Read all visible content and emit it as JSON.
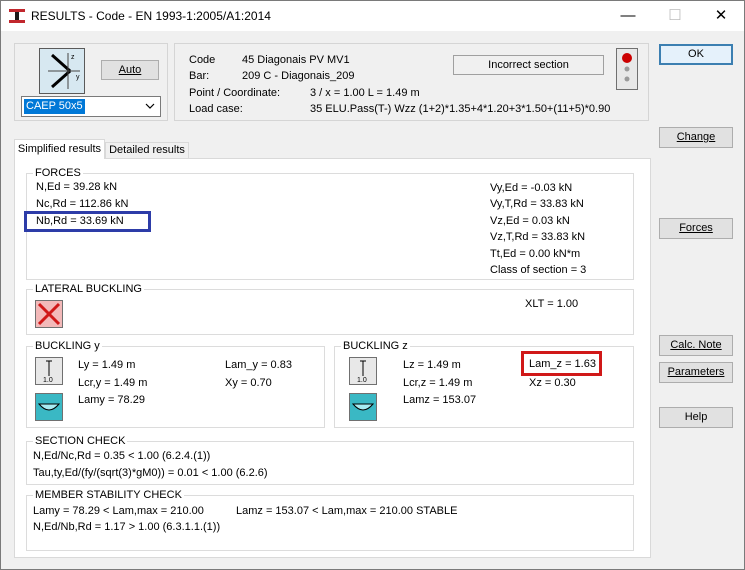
{
  "window": {
    "title": "RESULTS - Code - EN 1993-1:2005/A1:2014",
    "minimize": "—",
    "maximize": "☐",
    "close": "✕"
  },
  "header": {
    "auto_label": "Auto",
    "section_select": "CAEP 50x5",
    "code_label": "Code",
    "code_value": "45  Diagonais PV MV1",
    "bar_label": "Bar:",
    "bar_value": "209  C - Diagonais_209",
    "point_label": "Point / Coordinate:",
    "point_value": "3 / x = 1.00 L = 1.49 m",
    "load_label": "Load case:",
    "load_value": "35 ELU.Pass(T-) Wzz  (1+2)*1.35+4*1.20+3*1.50+(11+5)*0.90",
    "status": "Incorrect section"
  },
  "buttons": {
    "ok": "OK",
    "change": "Change",
    "forces": "Forces",
    "calc_note": "Calc. Note",
    "parameters": "Parameters",
    "help": "Help"
  },
  "tabs": {
    "simplified": "Simplified results",
    "detailed": "Detailed results"
  },
  "forces": {
    "title": "FORCES",
    "ned": "N,Ed = 39.28 kN",
    "ncrd": "Nc,Rd = 112.86 kN",
    "nbrd": "Nb,Rd = 33.69 kN",
    "vyed": "Vy,Ed = -0.03 kN",
    "vytrd": "Vy,T,Rd = 33.83 kN",
    "vzed": "Vz,Ed = 0.03 kN",
    "vztrd": "Vz,T,Rd = 33.83 kN",
    "tted": "Tt,Ed = 0.00 kN*m",
    "class": "Class of section = 3"
  },
  "lateral": {
    "title": "LATERAL BUCKLING",
    "xlt": "XLT = 1.00"
  },
  "buckling_y": {
    "title": "BUCKLING y",
    "ly": "Ly = 1.49 m",
    "lcry": "Lcr,y = 1.49 m",
    "lamy": "Lamy = 78.29",
    "lam_y": "Lam_y = 0.83",
    "xy": "Xy = 0.70",
    "icon_value": "1.0"
  },
  "buckling_z": {
    "title": "BUCKLING z",
    "lz": "Lz = 1.49 m",
    "lcrz": "Lcr,z = 1.49 m",
    "lamz": "Lamz = 153.07",
    "lam_z": "Lam_z = 1.63",
    "xz": "Xz = 0.30",
    "icon_value": "1.0"
  },
  "section_check": {
    "title": "SECTION CHECK",
    "line1": "N,Ed/Nc,Rd = 0.35 < 1.00   (6.2.4.(1))",
    "line2": "Tau,ty,Ed/(fy/(sqrt(3)*gM0)) = 0.01 < 1.00   (6.2.6)"
  },
  "member_check": {
    "title": "MEMBER STABILITY CHECK",
    "line1a": "Lamy = 78.29 < Lam,max = 210.00",
    "line1b": "Lamz = 153.07 < Lam,max = 210.00    STABLE",
    "line2": "N,Ed/Nb,Rd = 1.17 > 1.00   (6.3.1.1.(1))"
  },
  "colors": {
    "highlight_blue": "#2d3ca8",
    "highlight_red": "#d01818",
    "status_red": "#cc0000"
  }
}
